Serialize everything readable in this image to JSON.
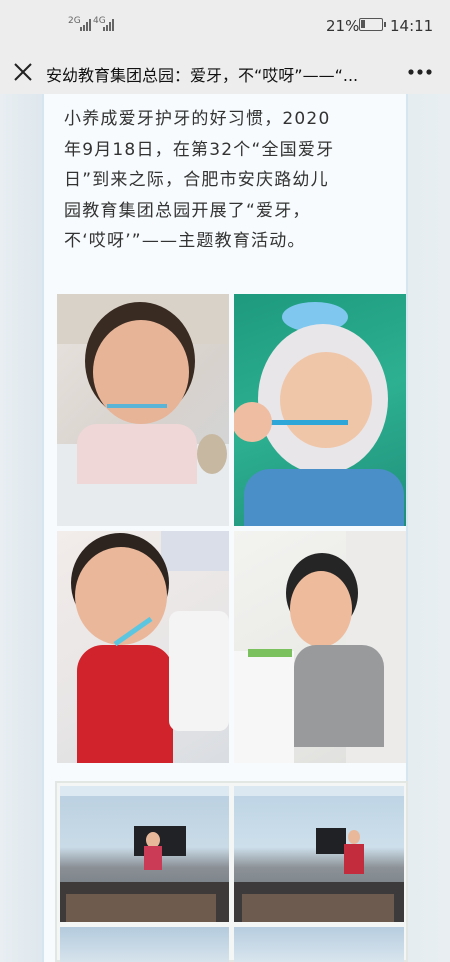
{
  "status_bar": {
    "signal_1": "2G",
    "signal_2": "4G",
    "battery_percent": "21%",
    "battery_level": 0.21,
    "time": "14:11"
  },
  "nav_bar": {
    "close_icon": "close-icon",
    "title": "安幼教育集团总园：爱牙，不“哎呀”——“...",
    "more_icon": "more-icon"
  },
  "article": {
    "lines": [
      "小养成爱牙护牙的好习惯，2020",
      "年9月18日，在第32个“全国爱牙",
      "日”到来之际，合肥市安庆路幼儿",
      "园教育集团总园开展了“爱牙，",
      "不‘哎呀’”——主题教育活动。"
    ]
  },
  "colors": {
    "page_bg": "#eef1f3",
    "bar_bg": "#ededed",
    "panel_bg": "#f7fbfd",
    "text": "#333333"
  }
}
